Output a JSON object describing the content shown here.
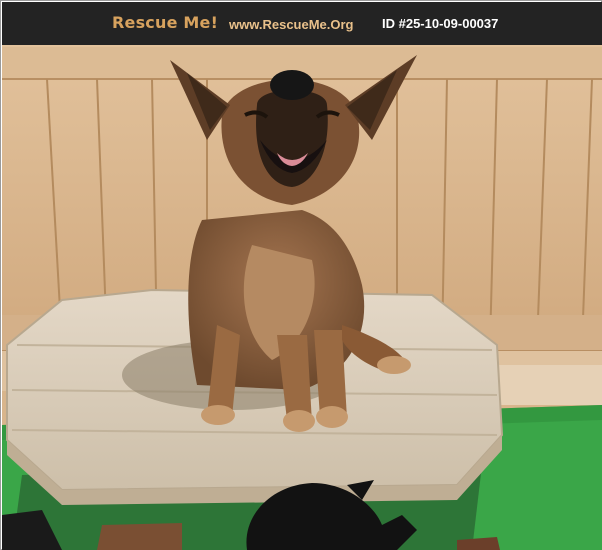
{
  "header": {
    "brand": "Rescue Me!",
    "site_url": "www.RescueMe.Org",
    "listing_id": "ID #25-10-09-00037"
  },
  "photo": {
    "subject_icon": "dog-photo",
    "colors": {
      "fence": "#d9b68d",
      "grass": "#3aa648",
      "table": "#ddd0bd",
      "dog": "#8a5a35",
      "header_bg": "#232323",
      "brand": "#d7a25e"
    }
  }
}
